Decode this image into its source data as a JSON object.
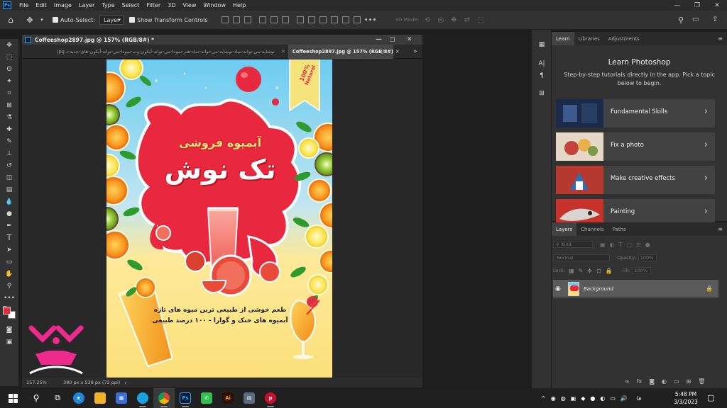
{
  "app": {
    "logo_text": "Ps",
    "menu": [
      "File",
      "Edit",
      "Image",
      "Layer",
      "Type",
      "Select",
      "Filter",
      "3D",
      "View",
      "Window",
      "Help"
    ],
    "window_controls": [
      "—",
      "❐",
      "✕"
    ]
  },
  "options_bar": {
    "auto_select_label": "Auto-Select:",
    "auto_select_value": "Layer",
    "show_transform_label": "Show Transform Controls",
    "mode_3d_label": "3D Mode:"
  },
  "document": {
    "window_title": "Coffeeshop2897.jpg @ 157% (RGB/8#) *",
    "tabs": [
      {
        "label": "نوشابه-می-تواند-نماد-نوشابه-می-تواند-نماد-هنر-سودا-می-تواند-آیکون-وب-سودا-می-تواند-آیکون-های-جدید-د.jpg",
        "active": false
      },
      {
        "label": "Coffeeshop2897.jpg @ 157% (RGB/8#) *",
        "active": true
      }
    ],
    "zoom": "157.25%",
    "dimensions": "380 px x 538 px (72 ppi)"
  },
  "poster": {
    "badge_line1": "100%",
    "badge_line2": "Natural",
    "subtitle": "آبمیوه فروشی",
    "title": "تک نوش",
    "tagline1": "طعم خوشی از طبیعی ترین میوه های تازه",
    "tagline2": "آبمیوه های خنک و گوارا - ۱۰۰ درصد طبیعی",
    "colors": {
      "sky": "#7fd3f0",
      "yellow": "#fbe88a",
      "splash": "#e8283f",
      "juice": "#f59a1b"
    }
  },
  "learn_panel": {
    "tabs": [
      "Learn",
      "Libraries",
      "Adjustments"
    ],
    "heading": "Learn Photoshop",
    "description": "Step-by-step tutorials directly in the app. Pick a topic below to begin.",
    "cards": [
      {
        "label": "Fundamental Skills"
      },
      {
        "label": "Fix a photo"
      },
      {
        "label": "Make creative effects"
      },
      {
        "label": "Painting"
      }
    ]
  },
  "layers_panel": {
    "tabs": [
      "Layers",
      "Channels",
      "Paths"
    ],
    "filter_placeholder": "Kind",
    "blend_mode": "Normal",
    "opacity_label": "Opacity:",
    "opacity_value": "100%",
    "lock_label": "Lock:",
    "fill_label": "Fill:",
    "fill_value": "100%",
    "layer_name": "Background"
  },
  "taskbar": {
    "time": "5:48 PM",
    "date": "3/3/2023",
    "lang": "فا"
  }
}
